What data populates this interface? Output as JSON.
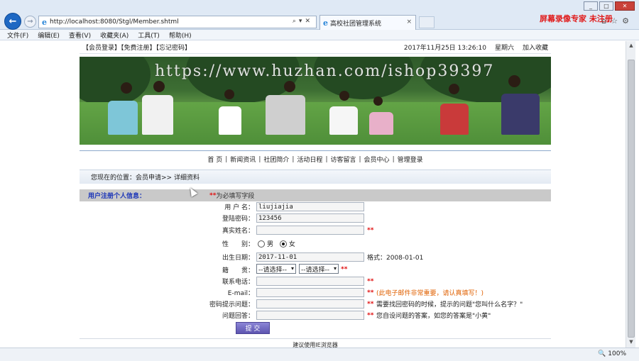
{
  "browser": {
    "url": "http://localhost:8080/Stgl/Member.shtml",
    "tab_title": "高校社团管理系统",
    "recorder_text": "屏幕录像专家 未注册",
    "menu": [
      "文件(F)",
      "编辑(E)",
      "查看(V)",
      "收藏夹(A)",
      "工具(T)",
      "帮助(H)"
    ],
    "zoom": "🔍 100%",
    "accent": "#1e68c3"
  },
  "topbar": {
    "links": "【会员登录】【免费注册】【忘记密码】",
    "datetime": "2017年11月25日 13:26:10",
    "weekday": "星期六",
    "favorite": "加入收藏"
  },
  "banner": {
    "watermark": "https://www.huzhan.com/ishop39397"
  },
  "nav": {
    "items": [
      "首 页",
      "新闻资讯",
      "社团简介",
      "活动日程",
      "访客留言",
      "会员中心",
      "管理登录"
    ]
  },
  "breadcrumb": "您现在的位置：会员申请>> 详细资料",
  "form": {
    "title": "用户注册个人信息：",
    "required_marker": "**",
    "required_note": "为必填写字段",
    "username_label": "用 户 名：",
    "username_value": "liujiajia",
    "password_label": "登陆密码：",
    "password_value": "123456",
    "realname_label": "真实姓名：",
    "gender_label": "性　　别：",
    "gender_male": "男",
    "gender_female": "女",
    "gender_selected": "女",
    "birthday_label": "出生日期：",
    "birthday_value": "2017-11-01",
    "birthday_hint": "格式：2008-01-01",
    "native_label": "籍　　贯：",
    "province_select": "--请选择--",
    "city_select": "--请选择--",
    "phone_label": "联系电话：",
    "email_label": "E-mail：",
    "email_hint": "(此电子邮件非常重要，请认真填写！)",
    "question_label": "密码提示问题：",
    "question_hint": "需要找回密码的时候，提示的问题\"您叫什么名字？\"",
    "answer_label": "问题回答：",
    "answer_hint": "您自设问题的答案，如您的答案是\"小黄\"",
    "submit_label": "提 交"
  },
  "footer": "建议使用IE浏览器"
}
